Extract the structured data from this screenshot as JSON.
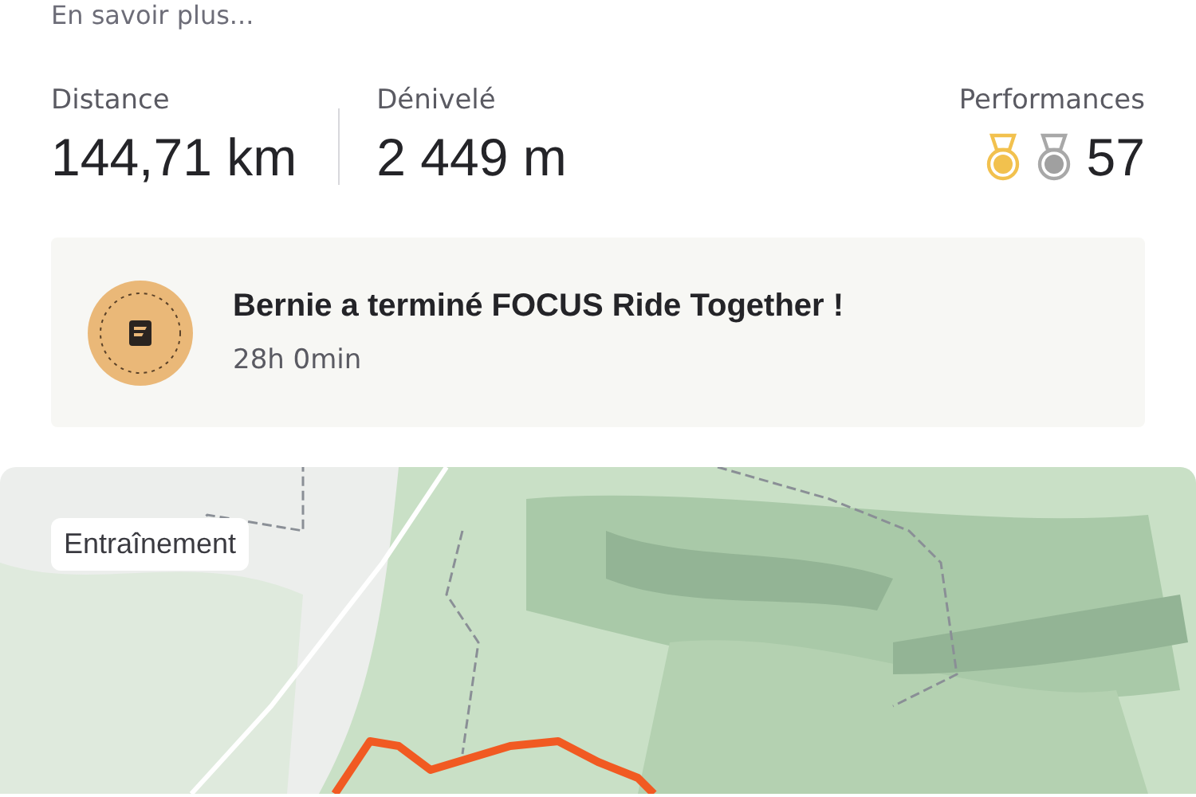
{
  "link": "En savoir plus...",
  "stats": [
    {
      "label": "Distance",
      "value": "144,71 km"
    },
    {
      "label": "Dénivelé",
      "value": "2 449 m"
    }
  ],
  "performances": {
    "label": "Performances",
    "count": "57"
  },
  "challenge": {
    "title": "Bernie a terminé FOCUS Ride Together !",
    "duration": "28h 0min"
  },
  "map": {
    "kind": "picture",
    "tag": "Entraînement"
  }
}
